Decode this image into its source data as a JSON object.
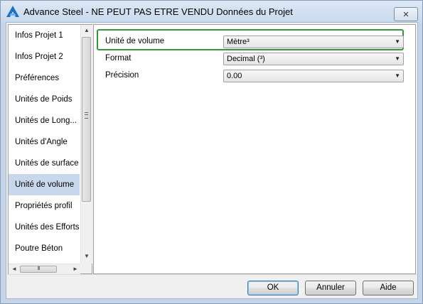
{
  "window": {
    "title": "Advance Steel - NE PEUT PAS ETRE VENDU  Données du Projet",
    "close_symbol": "✕"
  },
  "sidebar": {
    "items": [
      {
        "label": "Infos Projet 1"
      },
      {
        "label": "Infos Projet 2"
      },
      {
        "label": "Préférences"
      },
      {
        "label": "Unités de Poids"
      },
      {
        "label": "Unités de Long..."
      },
      {
        "label": "Unités d'Angle"
      },
      {
        "label": "Unités de surface"
      },
      {
        "label": "Unité de volume",
        "selected": true
      },
      {
        "label": "Propriétés profil"
      },
      {
        "label": "Unités des Efforts"
      },
      {
        "label": "Poutre Béton"
      }
    ],
    "scroll_up": "▲",
    "scroll_down": "▼",
    "scroll_left": "◄",
    "scroll_right": "►",
    "hgrip": "III"
  },
  "properties": {
    "unit": {
      "label": "Unité de volume",
      "value": "Mètre³"
    },
    "format": {
      "label": "Format",
      "value": "Decimal (³)"
    },
    "precision": {
      "label": "Précision",
      "value": "0.00"
    },
    "dropdown_symbol": "▼"
  },
  "buttons": {
    "ok": "OK",
    "cancel": "Annuler",
    "help": "Aide"
  },
  "colors": {
    "highlight_frame": "#2e9b33",
    "selected_item": "#c9d7ec",
    "window_frame": "#c4d5ea"
  },
  "icons": {
    "app": "advance-steel-logo-icon",
    "close": "close-icon",
    "dropdown": "chevron-down-icon"
  }
}
